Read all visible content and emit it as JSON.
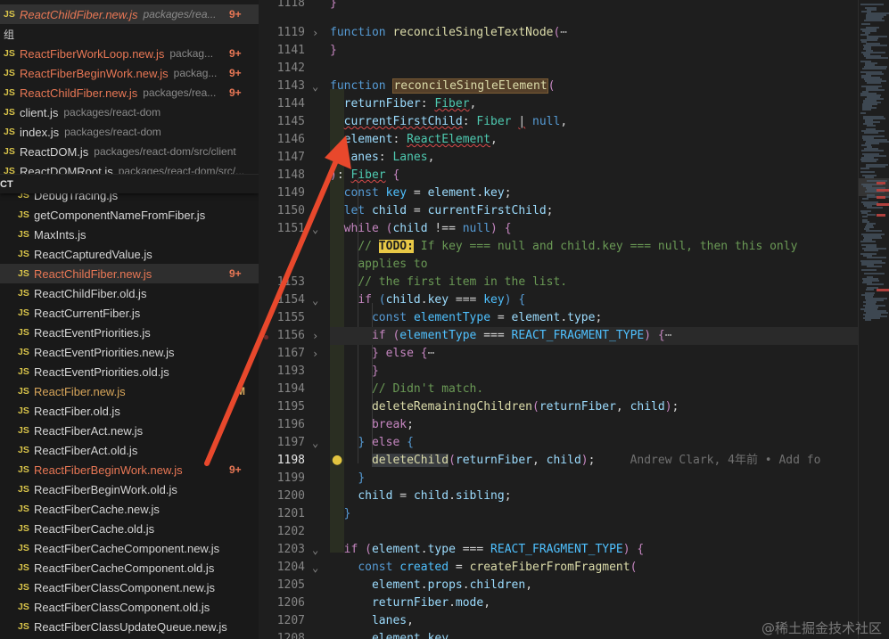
{
  "open_editors": {
    "items": [
      {
        "badge": "JS",
        "name": "ReactChildFiber.new.js",
        "path": "packages/rea...",
        "count": "9+",
        "modified": true,
        "italic": true,
        "active": true
      },
      {
        "group": true,
        "label": "组"
      },
      {
        "badge": "JS",
        "name": "ReactFiberWorkLoop.new.js",
        "path": "packag...",
        "count": "9+",
        "modified": true
      },
      {
        "badge": "JS",
        "name": "ReactFiberBeginWork.new.js",
        "path": "packag...",
        "count": "9+",
        "modified": true
      },
      {
        "badge": "JS",
        "name": "ReactChildFiber.new.js",
        "path": "packages/rea...",
        "count": "9+",
        "modified": true
      },
      {
        "badge": "JS",
        "name": "client.js",
        "path": "packages/react-dom",
        "modified": false
      },
      {
        "badge": "JS",
        "name": "index.js",
        "path": "packages/react-dom",
        "modified": false
      },
      {
        "badge": "JS",
        "name": "ReactDOM.js",
        "path": "packages/react-dom/src/client",
        "modified": false
      },
      {
        "badge": "JS",
        "name": "ReactDOMRoot.js",
        "path": "packages/react-dom/src/...",
        "modified": false
      }
    ]
  },
  "explorer": {
    "section_label": "CT",
    "files": [
      {
        "name": "DebugTracing.js"
      },
      {
        "name": "getComponentNameFromFiber.js"
      },
      {
        "name": "MaxInts.js"
      },
      {
        "name": "ReactCapturedValue.js"
      },
      {
        "name": "ReactChildFiber.new.js",
        "count": "9+",
        "style": "mod",
        "selected": true
      },
      {
        "name": "ReactChildFiber.old.js"
      },
      {
        "name": "ReactCurrentFiber.js"
      },
      {
        "name": "ReactEventPriorities.js"
      },
      {
        "name": "ReactEventPriorities.new.js"
      },
      {
        "name": "ReactEventPriorities.old.js"
      },
      {
        "name": "ReactFiber.new.js",
        "count": "M",
        "style": "orange"
      },
      {
        "name": "ReactFiber.old.js"
      },
      {
        "name": "ReactFiberAct.new.js"
      },
      {
        "name": "ReactFiberAct.old.js"
      },
      {
        "name": "ReactFiberBeginWork.new.js",
        "count": "9+",
        "style": "mod"
      },
      {
        "name": "ReactFiberBeginWork.old.js"
      },
      {
        "name": "ReactFiberCache.new.js"
      },
      {
        "name": "ReactFiberCache.old.js"
      },
      {
        "name": "ReactFiberCacheComponent.new.js"
      },
      {
        "name": "ReactFiberCacheComponent.old.js"
      },
      {
        "name": "ReactFiberClassComponent.new.js"
      },
      {
        "name": "ReactFiberClassComponent.old.js"
      },
      {
        "name": "ReactFiberClassUpdateQueue.new.js"
      }
    ]
  },
  "editor": {
    "line_numbers": [
      "1118",
      "1119",
      "1141",
      "1142",
      "1143",
      "1144",
      "1145",
      "1146",
      "1147",
      "1148",
      "1149",
      "1150",
      "1151",
      "",
      "1153",
      "1154",
      "1155",
      "1156",
      "1167",
      "1193",
      "1194",
      "1195",
      "1196",
      "1197",
      "1198",
      "1199",
      "1200",
      "1201",
      "1202",
      "1203",
      "1204",
      "1205",
      "1206",
      "1207",
      "1208"
    ],
    "current_line": "1198",
    "blame": "Andrew Clark, 4年前 • Add fo"
  },
  "watermark": "@稀土掘金技术社区",
  "colors": {
    "arrow": "#e8482c",
    "keyword": "#569cd6",
    "function": "#dcdcaa",
    "comment": "#6a9955",
    "modified": "#e87755"
  }
}
